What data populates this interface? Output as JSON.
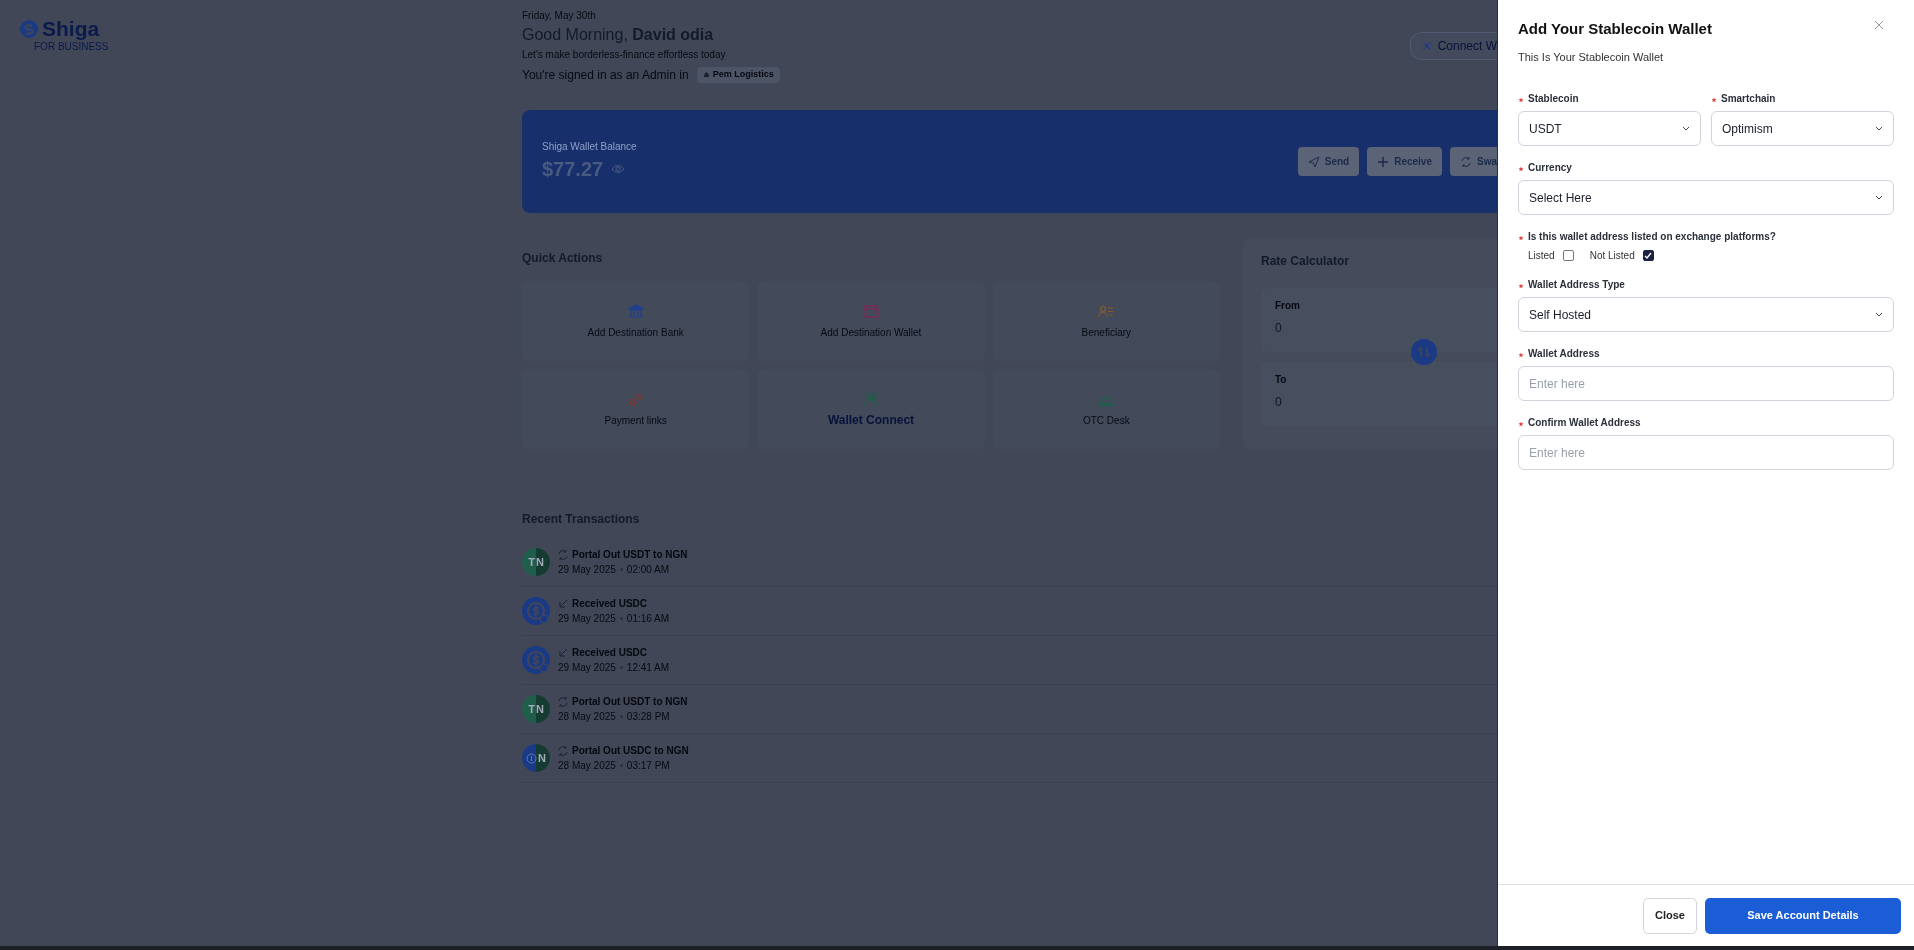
{
  "brand": {
    "name": "Shiga",
    "tagline": "FOR BUSINESS"
  },
  "header": {
    "date": "Friday, May 30th",
    "greeting": "Good Morning,",
    "user": "David odia",
    "subtitle": "Let's make borderless-finance effortless today",
    "signed_in": "You're signed in as an Admin in",
    "organization": "Pem Logistics",
    "connect_button": "Connect W"
  },
  "balance": {
    "label": "Shiga Wallet Balance",
    "amount": "$77.27",
    "actions": [
      "Send",
      "Receive",
      "Swa"
    ]
  },
  "quick_actions": {
    "title": "Quick Actions",
    "items": [
      {
        "label": "Add Destination Bank",
        "selected": false
      },
      {
        "label": "Add Destination Wallet",
        "selected": false
      },
      {
        "label": "Beneficiary",
        "selected": false
      },
      {
        "label": "Payment links",
        "selected": false
      },
      {
        "label": "Wallet Connect",
        "selected": true
      },
      {
        "label": "OTC Desk",
        "selected": false
      }
    ]
  },
  "rate_calculator": {
    "title": "Rate Calculator",
    "from_label": "From",
    "from_value": "0",
    "to_label": "To",
    "to_value": "0"
  },
  "transactions": {
    "title": "Recent Transactions",
    "items": [
      {
        "kind": "swap",
        "from_symbol": "T",
        "to_symbol": "N",
        "title": "Portal Out USDT to NGN",
        "date": "29 May 2025",
        "time": "02:00 AM"
      },
      {
        "kind": "received",
        "title": "Received USDC",
        "date": "29 May 2025",
        "time": "01:16 AM"
      },
      {
        "kind": "received",
        "title": "Received USDC",
        "date": "29 May 2025",
        "time": "12:41 AM"
      },
      {
        "kind": "swap",
        "from_symbol": "T",
        "to_symbol": "N",
        "title": "Portal Out USDT to NGN",
        "date": "28 May 2025",
        "time": "03:28 PM"
      },
      {
        "kind": "swap",
        "to_symbol": "N",
        "title": "Portal Out USDC to NGN",
        "date": "28 May 2025",
        "time": "03:17 PM"
      }
    ]
  },
  "drawer": {
    "title": "Add Your Stablecoin Wallet",
    "subtitle": "This Is Your Stablecoin Wallet",
    "rows": [
      [
        {
          "kind": "select",
          "label": "Stablecoin",
          "required": true,
          "value": "USDT"
        },
        {
          "kind": "select",
          "label": "Smartchain",
          "required": true,
          "value": "Optimism"
        }
      ],
      [
        {
          "kind": "select",
          "label": "Currency",
          "required": true,
          "value": "Select Here"
        }
      ],
      [
        {
          "kind": "checks",
          "label": "Is this wallet address listed on exchange platforms?",
          "required": true,
          "options": [
            {
              "label": "Listed",
              "checked": false
            },
            {
              "label": "Not Listed",
              "checked": true
            }
          ]
        }
      ],
      [
        {
          "kind": "select",
          "label": "Wallet Address Type",
          "required": true,
          "value": "Self Hosted"
        }
      ],
      [
        {
          "kind": "input",
          "label": "Wallet Address",
          "required": true,
          "placeholder": "Enter here"
        }
      ],
      [
        {
          "kind": "input",
          "label": "Confirm Wallet Address",
          "required": true,
          "placeholder": "Enter here"
        }
      ]
    ],
    "buttons": [
      {
        "label": "Close",
        "kind": "secondary"
      },
      {
        "label": "Save Account Details",
        "kind": "primary"
      }
    ]
  }
}
